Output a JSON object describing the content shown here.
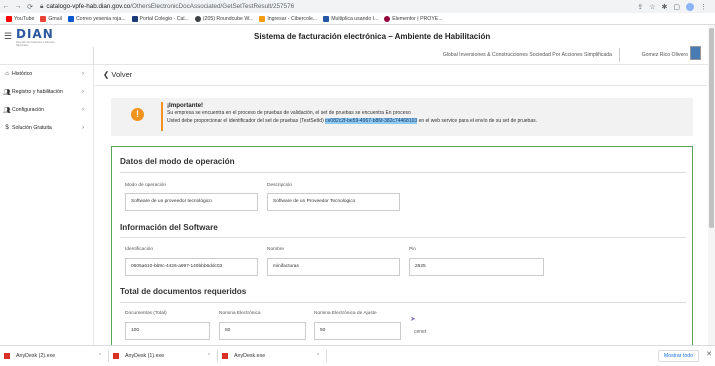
{
  "browser": {
    "url_domain": "catalogo-vpfe-hab.dian.gov.co",
    "url_path": "/OthersElectronicDocAssociated/GetSetTestResult/257576",
    "bookmarks": [
      "YouTube",
      "Gmail",
      "Correo yesenia roja...",
      "Portal Colegio - Cal...",
      "(205) Roundcube W...",
      "Ingresar - Cibercole...",
      "Multiplica usando l...",
      "Elementor | PROYE..."
    ],
    "bookmark_colors": [
      "#ff0000",
      "#ea4335",
      "#0b57d0",
      "#1a3a7a",
      "#3c4043",
      "#f39c12",
      "#2456a6",
      "#92003b"
    ]
  },
  "header": {
    "logo_text": "DIAN",
    "logo_subtext": "Dirección de Impuestos y Aduanas Nacionales",
    "title": "Sistema de facturación electrónica – Ambiente de Habilitación",
    "company": "Global Inversiones & Construcciones Sociedad Por Acciones Simplificada",
    "user": "Gomez Rico Olivero"
  },
  "sidebar": {
    "items": [
      {
        "label": "Histórico",
        "icon": "home-icon"
      },
      {
        "label": "Registro y habilitación",
        "icon": "users-icon"
      },
      {
        "label": "Configuración",
        "icon": "users-icon"
      },
      {
        "label": "Solución Gratuita",
        "icon": "dollar-icon"
      }
    ]
  },
  "main": {
    "back_label": "Volver",
    "alert": {
      "title": "¡Importante!",
      "line1": "Su empresa se encuentra en el proceso de pruebas de validación, el set de pruebas se encuentra En proceso",
      "line2_pre": "Usted debe proporcionar el identificador del set de pruebas (TestSetId)",
      "line2_id": "ce082c2f-be59-4967-b86f-382c74468103",
      "line2_post": "en el web service para el envío de su set de pruebas."
    },
    "sections": {
      "operation": {
        "title": "Datos del modo de operación",
        "mode_label": "Modo de operación",
        "mode_value": "Software de un proveedor tecnológico",
        "desc_label": "Descripción",
        "desc_value": "Software de un Proveedor Tecnologico"
      },
      "software": {
        "title": "Información del Software",
        "id_label": "Identificación",
        "id_value": "0605a610-bb9c-4426-a997-140bbb6ddc03",
        "name_label": "Nombre",
        "name_value": "minifacturas",
        "pin_label": "Pin",
        "pin_value": "2525"
      },
      "totals": {
        "title": "Total de documentos requeridos",
        "docs_label": "Documentos (Total)",
        "docs_value": "100",
        "nomina_label": "Nomina Electrónica",
        "nomina_value": "50",
        "ajuste_label": "Nomina Electrónica de Ajuste",
        "ajuste_value": "50",
        "extra_text": "cenet"
      }
    }
  },
  "downloads": {
    "items": [
      "AnyDesk (2).exe",
      "AnyDesk (1).exe",
      "AnyDesk.exe"
    ],
    "show_all": "Mostrar todo"
  }
}
